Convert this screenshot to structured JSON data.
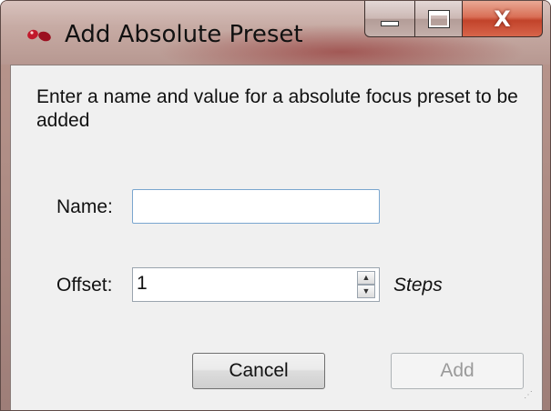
{
  "window": {
    "title": "Add Absolute Preset",
    "icon": "app-logo-icon",
    "controls": {
      "minimize": "minimize-icon",
      "maximize": "maximize-icon",
      "close_label": "X"
    }
  },
  "form": {
    "prompt": "Enter a name and value for a absolute focus preset to be added",
    "name_label": "Name:",
    "name_value": "",
    "offset_label": "Offset:",
    "offset_value": "1",
    "offset_unit": "Steps",
    "spin_up": "▲",
    "spin_down": "▼"
  },
  "buttons": {
    "cancel": "Cancel",
    "add": "Add",
    "add_enabled": false
  },
  "colors": {
    "close_button": "#c2432a",
    "input_focus_border": "#7aa6cf",
    "disabled_text": "#9a9a9a"
  }
}
